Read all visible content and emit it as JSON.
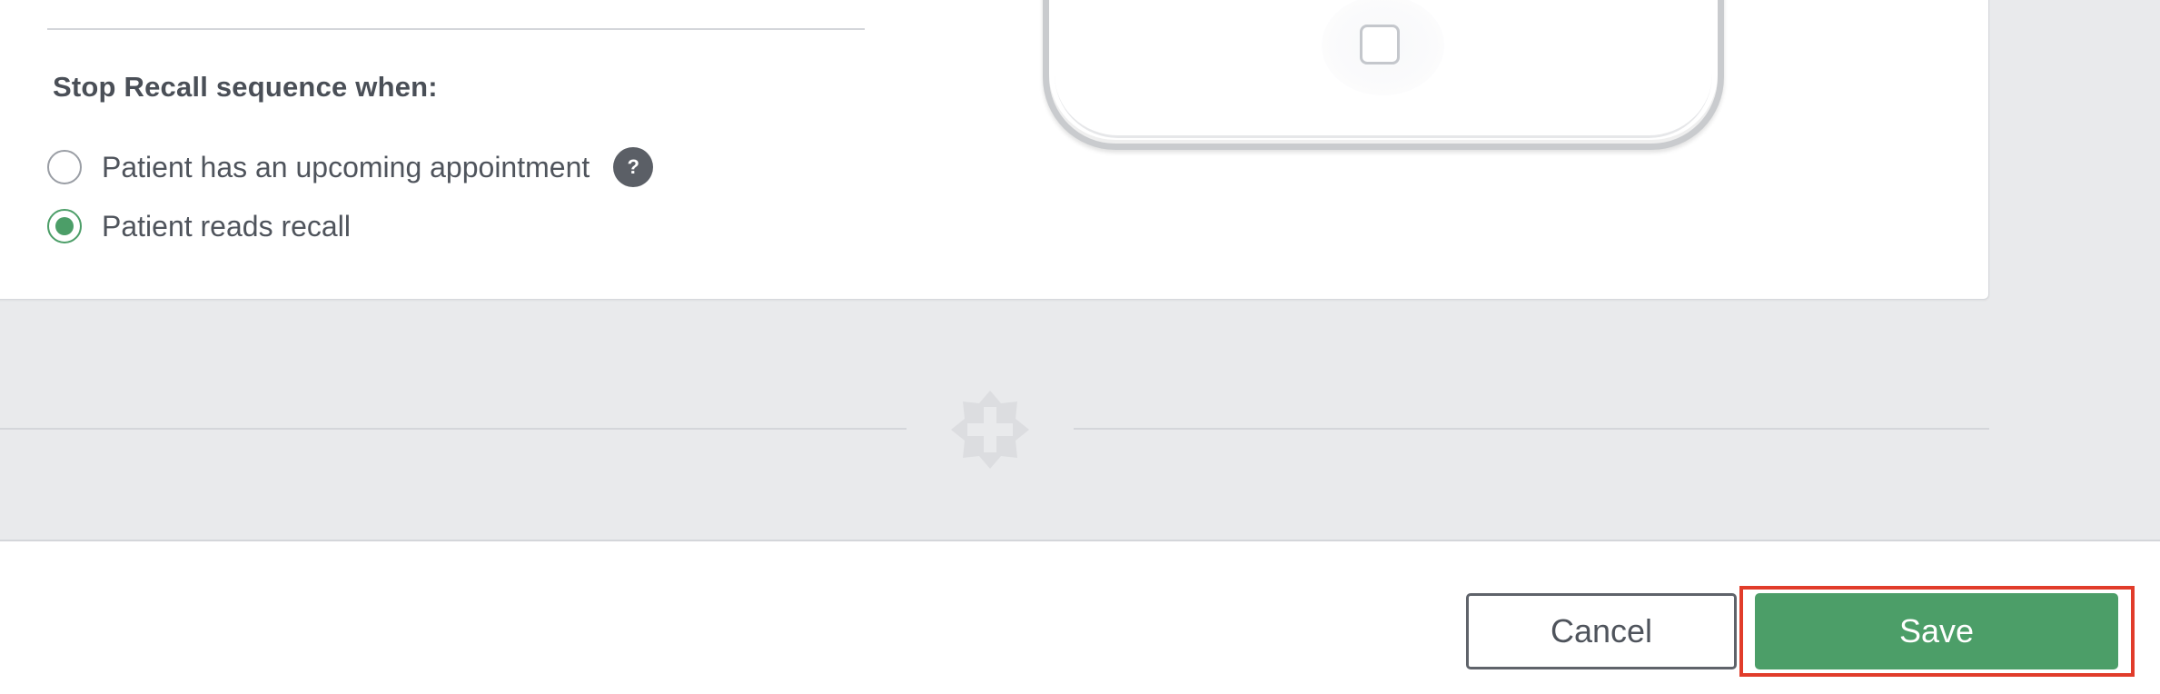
{
  "stop_recall": {
    "title": "Stop Recall sequence when:",
    "options": [
      {
        "label": "Patient has an upcoming appointment",
        "selected": false,
        "help": "?"
      },
      {
        "label": "Patient reads recall",
        "selected": true
      }
    ]
  },
  "footer": {
    "cancel_label": "Cancel",
    "save_label": "Save"
  },
  "colors": {
    "accent_green": "#4c9e68",
    "highlight_red": "#e13c2a"
  }
}
